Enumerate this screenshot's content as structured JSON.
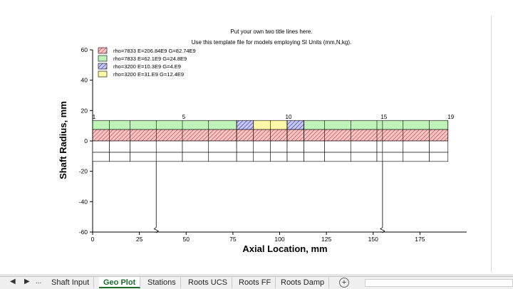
{
  "plot": {
    "title_line_1": "Put your own two title lines here.",
    "title_line_2": "Use this template file for models employing SI Units (mm,N,kg).",
    "xlabel": "Axial Location, mm",
    "ylabel": "Shaft Radius, mm",
    "legend": [
      {
        "label": "rho=7833  E=206.84E9  G=82.74E9",
        "color": "#f4b6b6",
        "hatch": "diag-red"
      },
      {
        "label": "rho=7833  E=62.1E9  G=24.8E9",
        "color": "#bff2b8",
        "hatch": "none"
      },
      {
        "label": "rho=3200  E=10.3E9  G=4.E9",
        "color": "#b8b8f0",
        "hatch": "diag-blue"
      },
      {
        "label": "rho=3200  E=31.E9  G=12.4E9",
        "color": "#fff7a8",
        "hatch": "none"
      }
    ],
    "station_labels": [
      "1",
      "5",
      "10",
      "15",
      "19"
    ]
  },
  "chart_data": {
    "type": "table",
    "x_ticks": [
      "0",
      "25",
      "50",
      "75",
      "100",
      "125",
      "150",
      "175"
    ],
    "y_ticks": [
      "60",
      "40",
      "20",
      "0",
      "-20",
      "-40",
      "-60"
    ],
    "xlim": [
      0,
      200
    ],
    "ylim": [
      -60,
      60
    ],
    "stations_x": [
      0,
      9,
      20,
      34,
      48,
      62,
      77,
      86,
      95,
      104,
      113,
      124,
      138,
      152,
      155,
      166,
      180,
      190
    ],
    "shaft_segments": [
      {
        "x0": 0,
        "x1": 77,
        "inner_outer": 7.5,
        "outer": 13.5,
        "outer_material": 1,
        "core_material": 0
      },
      {
        "x0": 77,
        "x1": 86,
        "inner_outer": 7.5,
        "outer": 13.5,
        "outer_material": 2,
        "core_material": 0
      },
      {
        "x0": 86,
        "x1": 104,
        "inner_outer": 7.5,
        "outer": 13.5,
        "outer_material": 3,
        "core_material": 0
      },
      {
        "x0": 104,
        "x1": 113,
        "inner_outer": 7.5,
        "outer": 13.5,
        "outer_material": 2,
        "core_material": 0
      },
      {
        "x0": 113,
        "x1": 190,
        "inner_outer": 7.5,
        "outer": 13.5,
        "outer_material": 1,
        "core_material": 0
      }
    ],
    "bearings_x": [
      34,
      155
    ]
  },
  "tabs": {
    "nav_prev": "◀",
    "nav_next": "▶",
    "ellipsis": "...",
    "items": [
      "Shaft Input",
      "Geo Plot",
      "Stations",
      "Roots UCS",
      "Roots FF",
      "Roots Damp"
    ],
    "active": "Geo Plot",
    "add": "+"
  }
}
